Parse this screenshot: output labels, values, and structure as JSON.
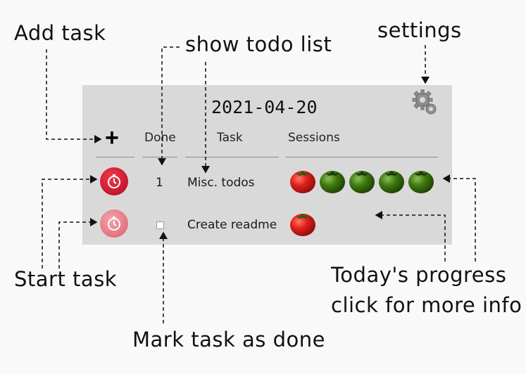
{
  "annotations": {
    "add_task": "Add task",
    "show_todo_list": "show todo list",
    "settings": "settings",
    "start_task": "Start task",
    "mark_done": "Mark task as done",
    "progress_line1": "Today's progress",
    "progress_line2": "click for more info"
  },
  "panel": {
    "date": "2021-04-20",
    "headers": {
      "done": "Done",
      "task": "Task",
      "sessions": "Sessions"
    },
    "rows": [
      {
        "done": "1",
        "task": "Misc. todos",
        "sessions_total": 5,
        "sessions_red": 1,
        "timer_state": "active"
      },
      {
        "done": "",
        "task": "Create readme",
        "sessions_total": 1,
        "sessions_red": 1,
        "timer_state": "inactive",
        "checkbox_checked": false
      }
    ]
  },
  "icons": {
    "add": "plus-icon",
    "settings": "gears-icon",
    "timer": "stopwatch-icon",
    "tomato_red": "red-tomato-icon",
    "tomato_green": "green-tomato-icon"
  },
  "colors": {
    "panel_bg": "#d9d9d9",
    "timer_red": "#d21f33",
    "tomato_red": "#e0201b",
    "tomato_green": "#3f7a10"
  }
}
